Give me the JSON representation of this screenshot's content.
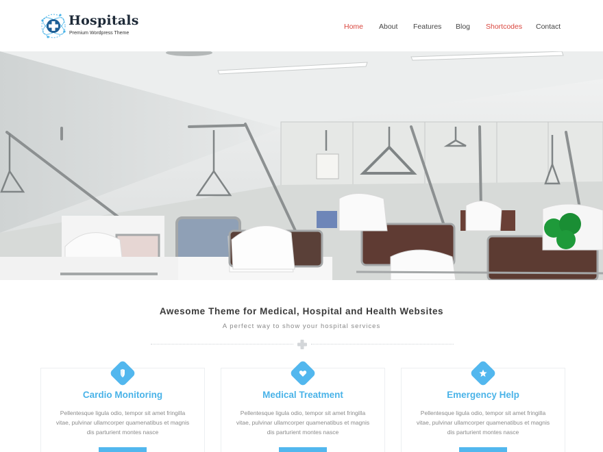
{
  "brand": {
    "name": "Hospitals",
    "tagline": "Premium Wordpress Theme",
    "accent": "#1e7ab8"
  },
  "nav": {
    "items": [
      {
        "label": "Home",
        "active": true
      },
      {
        "label": "About",
        "active": false
      },
      {
        "label": "Features",
        "active": false
      },
      {
        "label": "Blog",
        "active": false
      },
      {
        "label": "Shortcodes",
        "active": true
      },
      {
        "label": "Contact",
        "active": false
      }
    ]
  },
  "hero": {
    "image": "hospital-ward-photo"
  },
  "intro": {
    "title": "Awesome Theme for Medical, Hospital and Health Websites",
    "subtitle": "A perfect way to show your hospital services"
  },
  "cards": [
    {
      "icon": "shield-icon",
      "title": "Cardio Monitoring",
      "text": "Pellentesque ligula odio, tempor sit amet fringilla vitae, pulvinar ullamcorper quamenatibus et magnis dis parturient montes nasce"
    },
    {
      "icon": "heart-icon",
      "title": "Medical Treatment",
      "text": "Pellentesque ligula odio, tempor sit amet fringilla vitae, pulvinar ullamcorper quamenatibus et magnis dis parturient montes nasce"
    },
    {
      "icon": "star-icon",
      "title": "Emergency Help",
      "text": "Pellentesque ligula odio, tempor sit amet fringilla vitae, pulvinar ullamcorper quamenatibus et magnis dis parturient montes nasce"
    }
  ],
  "colors": {
    "nav_active": "#d9453d",
    "card_accent": "#4ab3e8",
    "badge": "#52b7ee"
  }
}
